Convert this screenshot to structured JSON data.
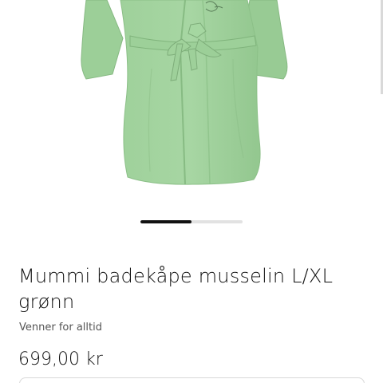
{
  "product": {
    "title": "Mummi badekåpe musselin L/XL grønn",
    "brand": "Venner for alltid",
    "price": "699,00 kr",
    "image_icon": "green-robe-product-photo",
    "color": "#9fd19b"
  },
  "carousel": {
    "progress_fraction": 0.5
  }
}
